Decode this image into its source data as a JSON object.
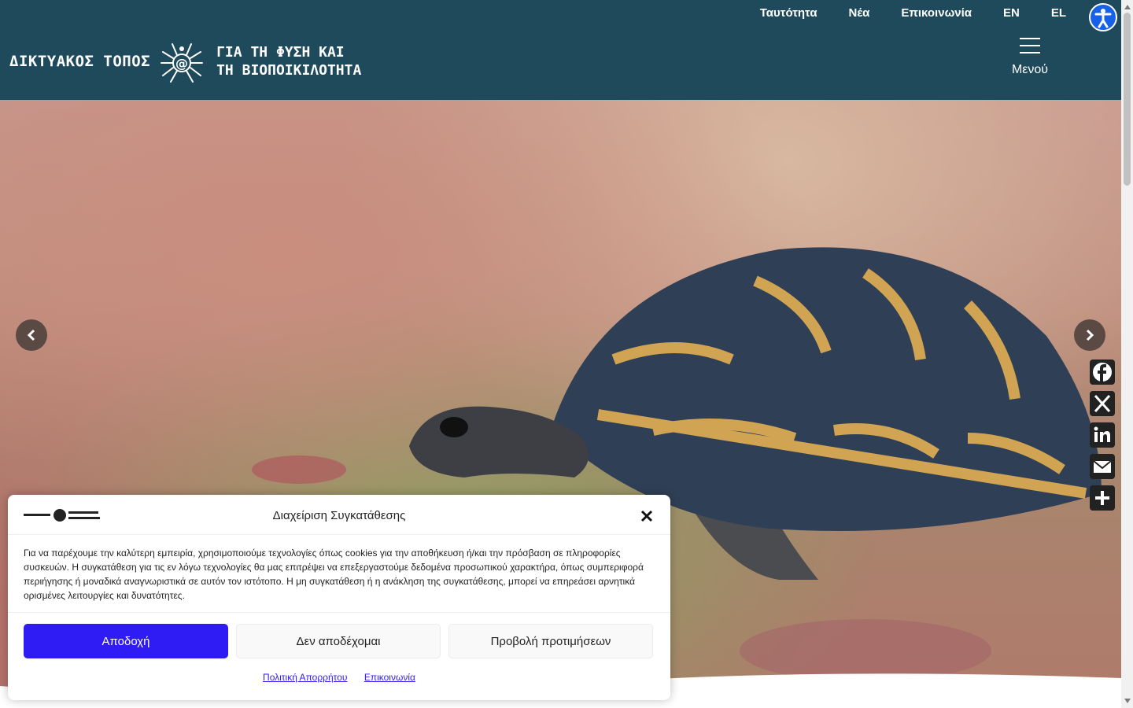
{
  "header": {
    "logo_left": "ΔΙΚΤΥΑΚΟΣ ΤΟΠΟΣ",
    "logo_right_line1": "ΓΙΑ ΤΗ ΦΥΣΗ ΚΑΙ",
    "logo_right_line2": "ΤΗ ΒΙΟΠΟΙΚΙΛΟΤΗΤΑ",
    "nav": [
      "Ταυτότητα",
      "Νέα",
      "Επικοινωνία",
      "EN",
      "EL"
    ],
    "menu_label": "Μενού",
    "background_color": "#1e4a5b"
  },
  "slider": {
    "prev_icon": "chevron-left-icon",
    "next_icon": "chevron-right-icon"
  },
  "share": {
    "items": [
      "facebook-icon",
      "x-icon",
      "linkedin-icon",
      "email-icon",
      "share-plus-icon"
    ]
  },
  "cookie": {
    "title": "Διαχείριση Συγκατάθεσης",
    "text": "Για να παρέχουμε την καλύτερη εμπειρία, χρησιμοποιούμε τεχνολογίες όπως cookies για την αποθήκευση ή/και την πρόσβαση σε πληροφορίες συσκευών. Η συγκατάθεση για τις εν λόγω τεχνολογίες θα μας επιτρέψει να επεξεργαστούμε δεδομένα προσωπικού χαρακτήρα, όπως συμπεριφορά περιήγησης ή μοναδικά αναγνωριστικά σε αυτόν τον ιστότοπο. Η μη συγκατάθεση ή η ανάκληση της συγκατάθεσης, μπορεί να επηρεάσει αρνητικά ορισμένες λειτουργίες και δυνατότητες.",
    "accept": "Αποδοχή",
    "decline": "Δεν αποδέχομαι",
    "preferences": "Προβολή προτιμήσεων",
    "link_privacy": "Πολιτική Απορρήτου",
    "link_contact": "Επικοινωνία",
    "accent_color": "#2f1cf5"
  }
}
